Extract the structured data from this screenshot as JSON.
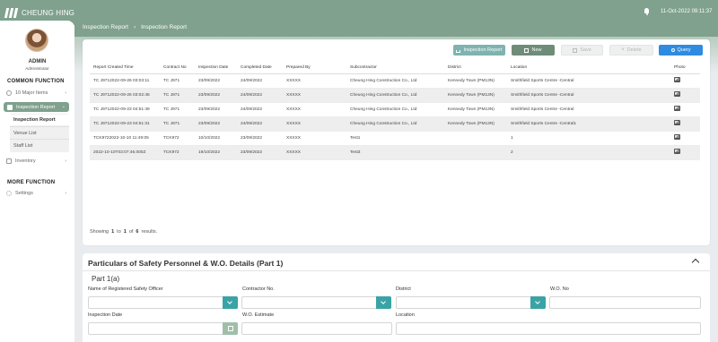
{
  "app": {
    "title": "CHEUNG HING",
    "datetime": "11-Oct-2022 09:11:37"
  },
  "user": {
    "name": "ADMIN",
    "role": "Administrator"
  },
  "sidebar": {
    "common_title": "COMMON FUNCTION",
    "items": [
      {
        "label": "10 Major Items",
        "icon": "clock-icon"
      },
      {
        "label": "Inspection Report",
        "icon": "document-icon"
      },
      {
        "label": "Inventory",
        "icon": "box-icon"
      }
    ],
    "sub_items": [
      {
        "label": "Inspection Report"
      },
      {
        "label": "Venue List"
      },
      {
        "label": "Staff List"
      }
    ],
    "more_title": "MORE FUNCTION",
    "more_items": [
      {
        "label": "Settings",
        "icon": "gear-icon"
      }
    ]
  },
  "breadcrumb": {
    "root": "Inspection Report",
    "sep": "›",
    "current": "Inspection Report"
  },
  "toolbar": {
    "inspection_report": "Inspection Report",
    "new": "New",
    "save": "Save",
    "delete": "Delete",
    "query": "Query"
  },
  "table": {
    "headers": [
      "Report Created Time",
      "Contract No",
      "Inspection Date",
      "Completed Date",
      "Prepared By",
      "Subcontractor",
      "District",
      "Location",
      "Photo"
    ],
    "rows": [
      [
        "TC J9712022-09-26 03:03:11",
        "TC J971",
        "23/09/2022",
        "24/09/2022",
        "XXXXX",
        "Cheung Hing Construction Co., Ltd",
        "Kennedy Town (PM13N)",
        "Smithfield Sports Centre -Central"
      ],
      [
        "TC J9712022-09-26 03:02:45",
        "TC J971",
        "23/09/2022",
        "24/09/2022",
        "XXXXX",
        "Cheung Hing Construction Co., Ltd",
        "Kennedy Town (PM13N)",
        "Smithfield Sports Centre -Central"
      ],
      [
        "TC J9712022-09-23 04:51:49",
        "TC J971",
        "23/09/2022",
        "24/09/2022",
        "XXXXX",
        "Cheung Hing Construction Co., Ltd",
        "Kennedy Town (PM13N)",
        "Smithfield Sports Centre -Central"
      ],
      [
        "TC J9712022-09-23 04:51:31",
        "TC J971",
        "23/09/2022",
        "24/09/2022",
        "XXXXX",
        "Cheung Hing Construction Co., Ltd",
        "Kennedy Town (PM13N)",
        "Smithfield Sports Centre -Central1"
      ],
      [
        "TCK9722022-10-10 11:49:05",
        "TCK972",
        "10/10/2022",
        "23/09/2022",
        "XXXXX",
        "Test1",
        "",
        "1"
      ],
      [
        "2022-10-10T03:07:46.000Z",
        "TCK972",
        "19/10/2022",
        "23/09/2022",
        "XXXXX",
        "Test3",
        "",
        "2"
      ]
    ]
  },
  "pagination": {
    "prefix": "Showing",
    "from": "1",
    "to_word": "to",
    "to": "1",
    "of_word": "of",
    "total": "6",
    "suffix": "results."
  },
  "details": {
    "title": "Particulars of Safety Personnel & W.O. Details (Part 1)",
    "section": "Part 1(a)",
    "labels": {
      "rso_name": "Name of Registered Safety Officer",
      "contractor_no": "Contractor No.",
      "district": "District",
      "wo_no": "W.O. No",
      "inspection_date": "Inspection Date",
      "wo_estimate": "W.O. Estimate",
      "location": "Location"
    }
  },
  "colors": {
    "brand": "#7fa18d",
    "query": "#2e8be0",
    "teal": "#3aa3a5"
  }
}
